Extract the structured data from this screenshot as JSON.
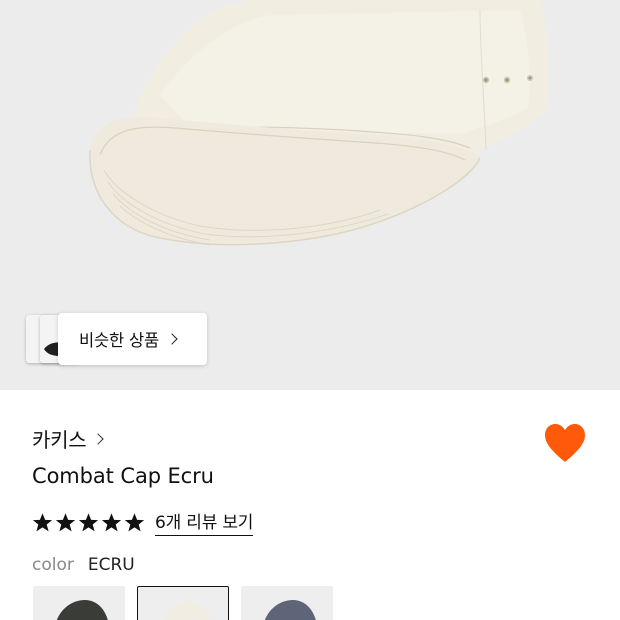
{
  "similar_products": {
    "label": "비슷한 상품"
  },
  "product": {
    "brand": "카키스",
    "name": "Combat Cap Ecru",
    "rating_stars": 5,
    "review_link": "6개 리뷰 보기",
    "color_label": "color",
    "color_value": "ECRU",
    "favorited": true
  },
  "color_options": [
    {
      "name": "dark-gray",
      "selected": false
    },
    {
      "name": "ecru",
      "selected": true
    },
    {
      "name": "navy",
      "selected": false
    }
  ],
  "colors": {
    "accent_heart": "#ff5a0a",
    "hero_background": "#ececec",
    "cap_fill": "#f2eee2"
  },
  "icons": [
    "chevron-right-icon",
    "heart-icon",
    "star-icon"
  ]
}
